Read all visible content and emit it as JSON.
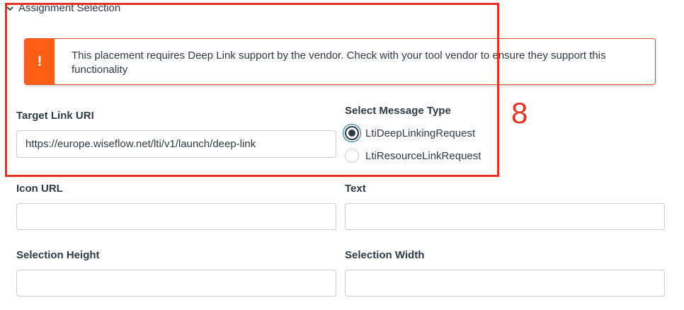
{
  "section": {
    "title": "Assignment Selection",
    "icon": "chevron-down-icon"
  },
  "alert": {
    "icon": "exclamation-icon",
    "message": "This placement requires Deep Link support by the vendor. Check with your tool vendor to ensure they support this functionality"
  },
  "target_link": {
    "label": "Target Link URI",
    "value": "https://europe.wiseflow.net/lti/v1/launch/deep-link"
  },
  "message_type": {
    "label": "Select Message Type",
    "options": [
      {
        "label": "LtiDeepLinkingRequest",
        "checked": true
      },
      {
        "label": "LtiResourceLinkRequest",
        "checked": false
      }
    ]
  },
  "icon_url": {
    "label": "Icon URL",
    "value": ""
  },
  "text": {
    "label": "Text",
    "value": ""
  },
  "selection_height": {
    "label": "Selection Height",
    "value": ""
  },
  "selection_width": {
    "label": "Selection Width",
    "value": ""
  },
  "annotation": {
    "step": "8",
    "color": "#e53323"
  },
  "colors": {
    "alert_accent": "#fc5e13",
    "text": "#2d3b45",
    "focus": "#0770a3"
  }
}
